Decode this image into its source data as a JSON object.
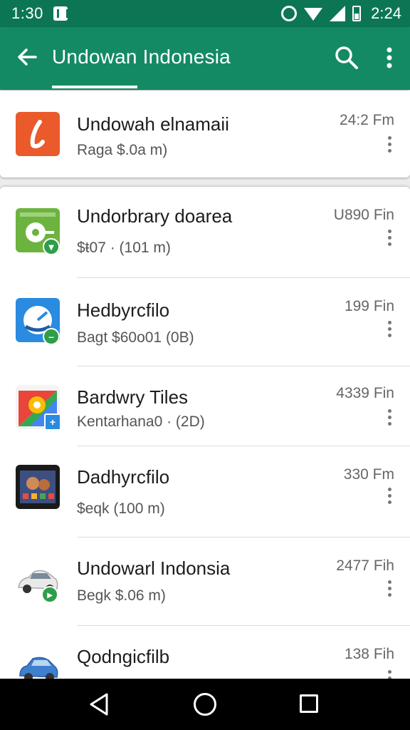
{
  "status_bar": {
    "time_left": "1:30",
    "time_right": "2:24",
    "icons": [
      "notification-icon",
      "alarm-icon",
      "wifi-icon",
      "signal-icon",
      "battery-icon"
    ]
  },
  "app_bar": {
    "title": "Undowan Indonesia",
    "back_icon": "arrow-left-icon",
    "search_icon": "search-icon",
    "menu_icon": "more-vertical-icon",
    "color": "#148a64"
  },
  "featured": {
    "name": "Undowah elnamaii",
    "meta": "Raga $.0a m)",
    "size": "24:2 Fm",
    "icon": "orange-l-logo-icon",
    "icon_color": "#ea5a2b"
  },
  "items": [
    {
      "name": "Undorbrary doarea",
      "meta": "$ŧ07 · (101 m)",
      "size": "U890 Fin",
      "icon": "green-app-icon",
      "badge": "cart-badge-icon"
    },
    {
      "name": "Hedbyrcfilo",
      "meta": "Bagt $60o01 (0B)",
      "size": "199 Fin",
      "icon": "blue-clock-app-icon",
      "badge": "minus-badge-icon"
    },
    {
      "name": "Bardwry Tiles",
      "meta": "Kentarhana0 · (2D)",
      "size": "4339 Fin",
      "icon": "maps-app-icon",
      "badge": "plus-badge-icon"
    },
    {
      "name": "Dadhyrcfilo",
      "meta": "$eqk (100 m)",
      "size": "330 Fm",
      "icon": "tablet-app-icon",
      "badge": ""
    },
    {
      "name": "Undowarl Indonsia",
      "meta": "Begk $.06 m)",
      "size": "2477 Fih",
      "icon": "white-car-icon",
      "badge": "play-badge-icon"
    },
    {
      "name": "Qodngicfilb",
      "meta": "",
      "size": "138 Fih",
      "icon": "blue-car-icon",
      "badge": ""
    }
  ],
  "nav_bar": {
    "back": "nav-back-icon",
    "home": "nav-home-icon",
    "recents": "nav-recents-icon"
  }
}
